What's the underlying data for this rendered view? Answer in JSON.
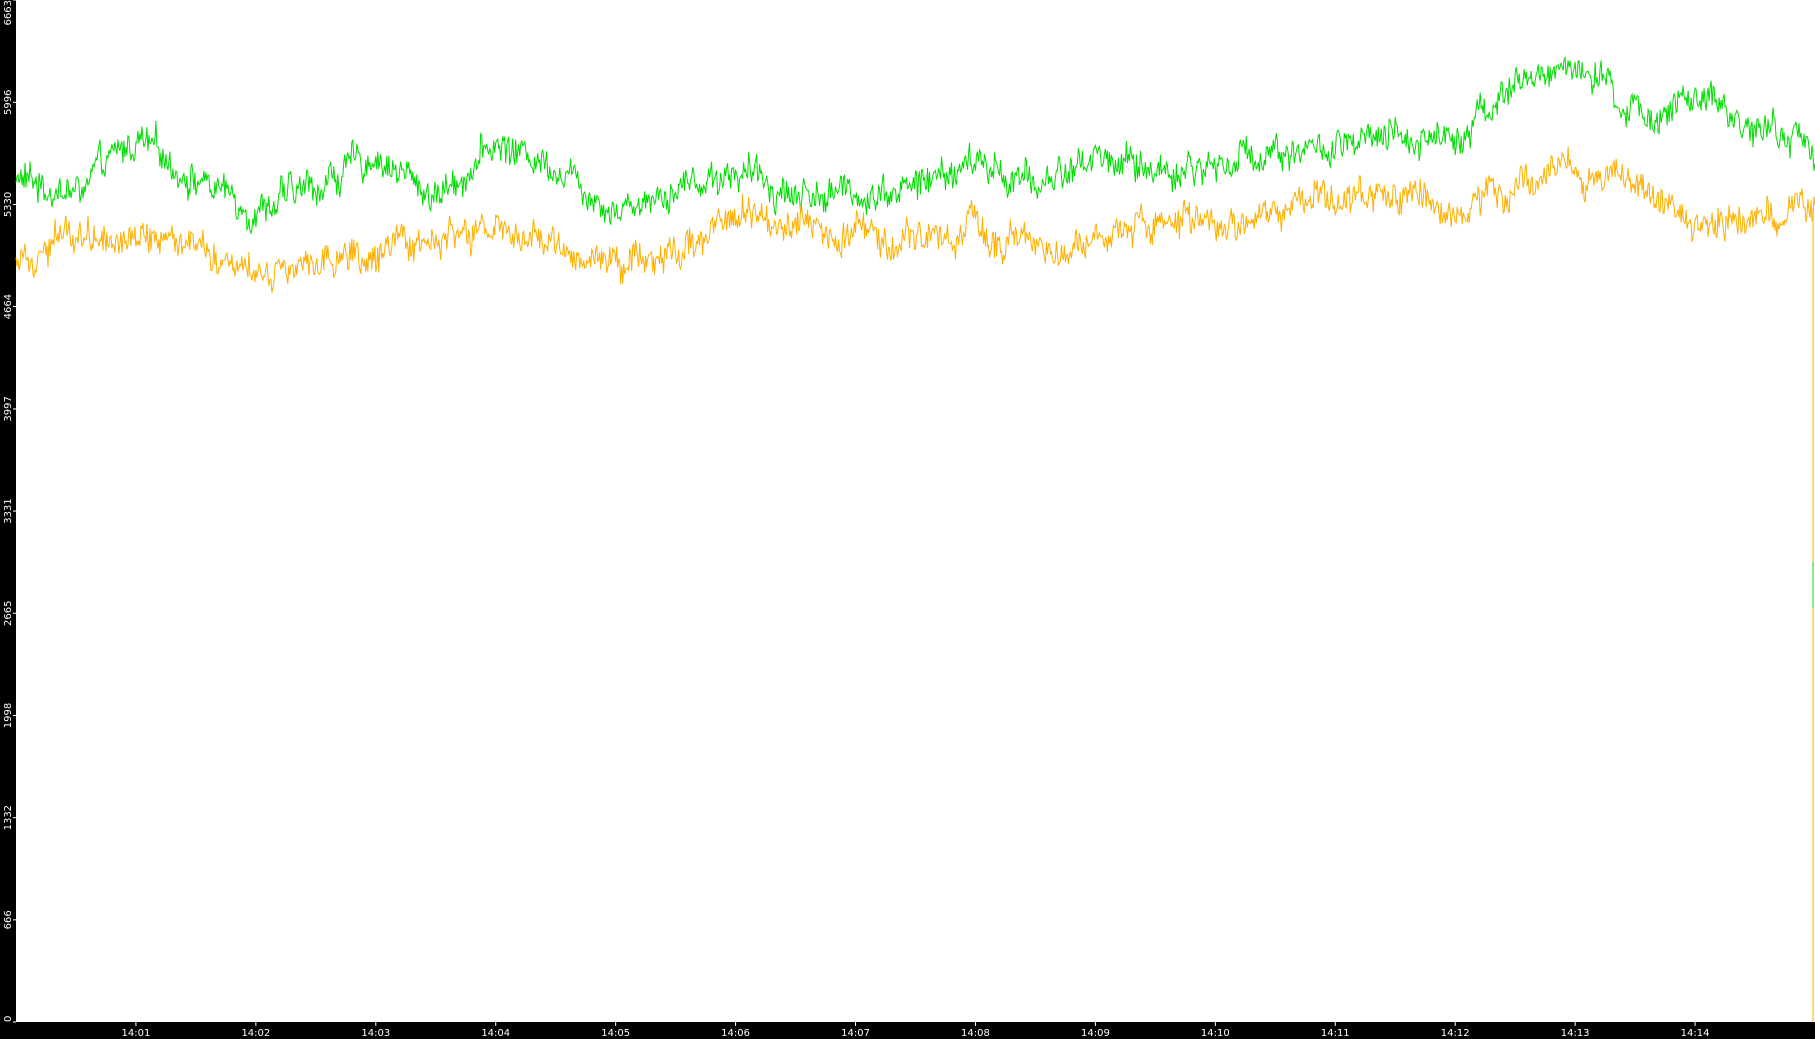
{
  "colors": {
    "background": "#000000",
    "plot_area": "#ffffff",
    "axis_text": "#ffffff",
    "series_green": "#00dd00",
    "series_orange": "#ffb000"
  },
  "chart_data": {
    "type": "line",
    "title": "",
    "xlabel": "",
    "ylabel": "",
    "ylim": [
      0,
      6663
    ],
    "yticks": [
      "0",
      "666",
      "1332",
      "1998",
      "2665",
      "3331",
      "3997",
      "4664",
      "5330",
      "5996",
      "6663"
    ],
    "x_range": [
      "14:00",
      "14:15"
    ],
    "xticks": [
      "14:01",
      "14:02",
      "14:03",
      "14:04",
      "14:05",
      "14:06",
      "14:07",
      "14:08",
      "14:09",
      "14:10",
      "14:11",
      "14:12",
      "14:13",
      "14:14"
    ],
    "grid": false,
    "legend": "none",
    "series": [
      {
        "color": "#00dd00",
        "x": [
          "14:00:00",
          "14:00:30",
          "14:01:00",
          "14:01:30",
          "14:02:00",
          "14:02:30",
          "14:03:00",
          "14:03:30",
          "14:04:00",
          "14:04:30",
          "14:05:00",
          "14:05:30",
          "14:06:00",
          "14:06:30",
          "14:07:00",
          "14:07:30",
          "14:08:00",
          "14:08:30",
          "14:09:00",
          "14:09:30",
          "14:10:00",
          "14:10:30",
          "14:11:00",
          "14:11:30",
          "14:12:00",
          "14:12:30",
          "14:13:00",
          "14:13:30",
          "14:14:00",
          "14:14:30",
          "14:15:00"
        ],
        "values": [
          5500,
          5400,
          5750,
          5500,
          5300,
          5450,
          5650,
          5380,
          5720,
          5600,
          5300,
          5450,
          5550,
          5400,
          5400,
          5450,
          5600,
          5450,
          5650,
          5550,
          5580,
          5700,
          5680,
          5750,
          5800,
          6100,
          6250,
          5900,
          6000,
          5850,
          5700
        ]
      },
      {
        "color": "#ffb000",
        "x": [
          "14:00:00",
          "14:00:30",
          "14:01:00",
          "14:01:30",
          "14:02:00",
          "14:02:30",
          "14:03:00",
          "14:03:30",
          "14:04:00",
          "14:04:30",
          "14:05:00",
          "14:05:30",
          "14:06:00",
          "14:06:30",
          "14:07:00",
          "14:07:30",
          "14:08:00",
          "14:08:30",
          "14:09:00",
          "14:09:30",
          "14:10:00",
          "14:10:30",
          "14:11:00",
          "14:11:30",
          "14:12:00",
          "14:12:30",
          "14:13:00",
          "14:13:30",
          "14:14:00",
          "14:14:30",
          "14:15:00"
        ],
        "values": [
          5000,
          5150,
          5150,
          5100,
          4900,
          5000,
          4950,
          5100,
          5150,
          5050,
          4950,
          5050,
          5250,
          5250,
          5150,
          5100,
          5150,
          5050,
          5100,
          5250,
          5150,
          5250,
          5400,
          5350,
          5300,
          5500,
          5550,
          5500,
          5150,
          5250,
          5300
        ]
      }
    ]
  }
}
